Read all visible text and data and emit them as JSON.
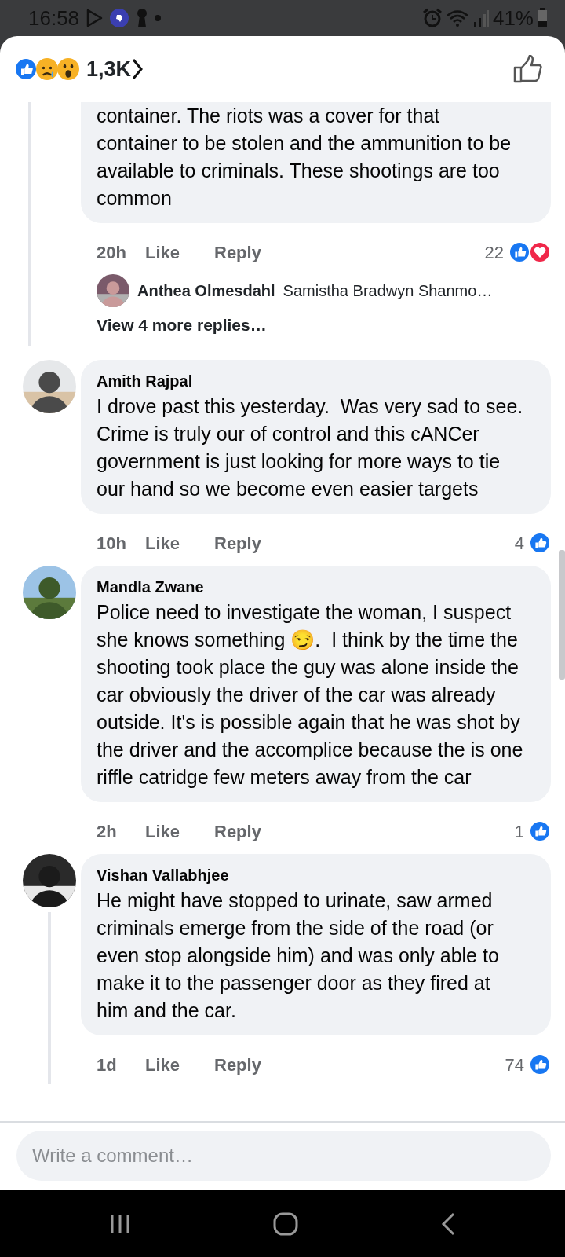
{
  "status_bar": {
    "time": "16:58",
    "battery": "41%"
  },
  "header": {
    "reactions": [
      {
        "kind": "like"
      },
      {
        "kind": "sad"
      },
      {
        "kind": "wow"
      }
    ],
    "reaction_count": "1,3K"
  },
  "comments": [
    {
      "kind": "continued",
      "text": "container. The riots was a cover for that container to be stolen and the ammunition to be available to criminals. These shootings are too common",
      "time": "20h",
      "like": "Like",
      "reply": "Reply",
      "reaction_count": "22",
      "reactions": [
        {
          "kind": "like"
        },
        {
          "kind": "love"
        }
      ],
      "thread": true,
      "reply_preview": {
        "author": "Anthea Olmesdahl",
        "text": "Samistha Bradwyn Shanmo…"
      },
      "more_replies": "View 4 more replies…"
    },
    {
      "kind": "full",
      "author": "Amith Rajpal",
      "text": "I drove past this yesterday.  Was very sad to see.  Crime is truly our of control and this cANCer government is just looking for more ways to tie our hand so we become even easier targets",
      "time": "10h",
      "like": "Like",
      "reply": "Reply",
      "reaction_count": "4",
      "reactions": [
        {
          "kind": "like"
        }
      ],
      "thread": false
    },
    {
      "kind": "full",
      "author": "Mandla Zwane",
      "text": "Police need to investigate the woman, I suspect she knows something 😏.  I think by the time the shooting took place the guy was alone inside the car obviously the driver of the car was already outside. It's is possible again that he was shot by the driver and the accomplice because the is one riffle catridge few meters away from the car",
      "time": "2h",
      "like": "Like",
      "reply": "Reply",
      "reaction_count": "1",
      "reactions": [
        {
          "kind": "like"
        }
      ],
      "thread": false
    },
    {
      "kind": "full",
      "author": "Vishan Vallabhjee",
      "text": "He might have stopped to urinate, saw armed criminals emerge from the side of the road (or even stop alongside him) and was only able to make it to the passenger door as they fired at him and the car.",
      "time": "1d",
      "like": "Like",
      "reply": "Reply",
      "reaction_count": "74",
      "reactions": [
        {
          "kind": "like"
        }
      ],
      "thread": true
    }
  ],
  "composer": {
    "placeholder": "Write a comment…"
  }
}
